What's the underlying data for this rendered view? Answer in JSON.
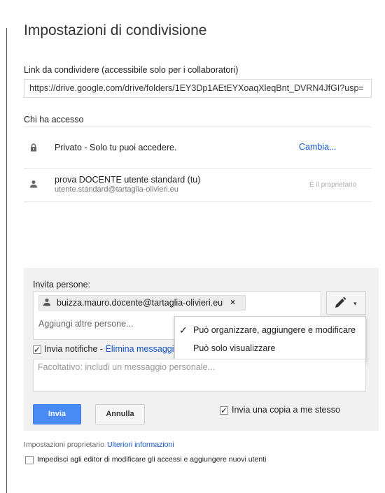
{
  "dialog": {
    "title": "Impostazioni di condivisione"
  },
  "share_link": {
    "label": "Link da condividere (accessibile solo per i collaboratori)",
    "value": "https://drive.google.com/drive/folders/1EY3Dp1AEtEYXoaqXleqBnt_DVRN4JfGI?usp="
  },
  "access": {
    "label": "Chi ha accesso",
    "visibility": {
      "icon": "lock-icon",
      "text": "Privato - Solo tu puoi accedere.",
      "change_label": "Cambia..."
    },
    "owner": {
      "icon": "person-icon",
      "name": "prova DOCENTE utente standard (tu)",
      "email": "utente.standard@tartaglia-olivieri.eu",
      "role": "È il proprietario"
    }
  },
  "invite": {
    "label": "Invita persone:",
    "chip_email": "buizza.mauro.docente@tartaglia-olivieri.eu",
    "chip_remove": "×",
    "add_placeholder": "Aggiungi altre persone...",
    "permission_icon": "pencil-icon",
    "permission_caret": "▾",
    "dropdown": {
      "options": [
        {
          "label": "Può organizzare, aggiungere e modificare",
          "selected": true
        },
        {
          "label": "Può solo visualizzare",
          "selected": false
        }
      ]
    },
    "notify_label": "Invia notifiche - ",
    "notify_link": "Elimina messaggio",
    "notify_checked": true,
    "message_placeholder": "Facoltativo: includi un messaggio personale...",
    "send_label": "Invia",
    "cancel_label": "Annulla",
    "copy_label": "Invia una copia a me stesso",
    "copy_checked": true
  },
  "owner_settings": {
    "label": "Impostazioni proprietario",
    "more_info": "Ulteriori informazioni",
    "prevent_label": "Impedisci agli editor di modificare gli accessi e aggiungere nuovi utenti",
    "prevent_checked": false
  },
  "colors": {
    "link": "#1155cc",
    "primary_button": "#4a8af4",
    "panel_bg": "#f1f1f1"
  }
}
